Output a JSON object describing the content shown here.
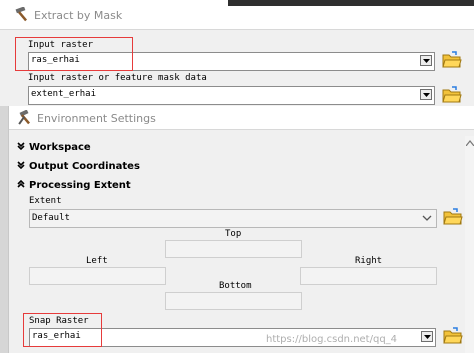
{
  "extract_dialog": {
    "title": "Extract by Mask",
    "input_raster_label": "Input raster",
    "input_raster_value": "ras_erhai",
    "mask_label": "Input raster or feature mask data",
    "mask_value": "extent_erhai"
  },
  "env_dialog": {
    "title": "Environment Settings",
    "sections": {
      "workspace": "Workspace",
      "output_coordinates": "Output Coordinates",
      "processing_extent": "Processing Extent"
    },
    "extent_label": "Extent",
    "extent_value": "Default",
    "top_label": "Top",
    "left_label": "Left",
    "right_label": "Right",
    "bottom_label": "Bottom",
    "snap_raster_label": "Snap Raster",
    "snap_raster_value": "ras_erhai"
  },
  "watermark": "https://blog.csdn.net/qq_4",
  "colors": {
    "highlight": "#e63b3b",
    "dialog_bg": "#f0f0f0",
    "title_text": "#8a8a8a"
  },
  "icons": [
    "hammer-icon",
    "tools-icon",
    "folder-open-icon",
    "chevron-down-icon",
    "double-chevron-down-icon",
    "double-chevron-up-icon"
  ]
}
